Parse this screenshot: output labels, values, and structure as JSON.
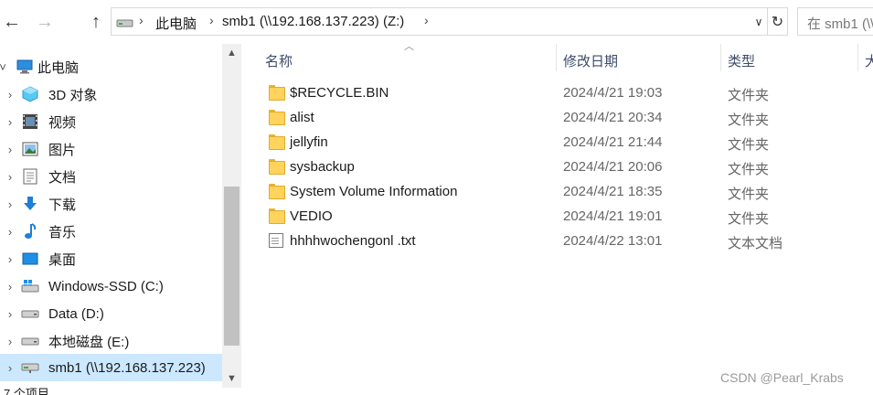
{
  "toolbar": {
    "back_icon": "←",
    "forward_icon": "→",
    "up_icon": "↑"
  },
  "address": {
    "crumbs": [
      "此电脑",
      "smb1 (\\\\192.168.137.223) (Z:)"
    ],
    "separator": "›",
    "dropdown_icon": "∨",
    "refresh_icon": "↻"
  },
  "search": {
    "placeholder": "在 smb1 (\\\\"
  },
  "nav": {
    "items": [
      {
        "label": "此电脑",
        "icon": "pc-icon",
        "expanded": true
      },
      {
        "label": "3D 对象",
        "icon": "3d-objects-icon"
      },
      {
        "label": "视频",
        "icon": "video-icon"
      },
      {
        "label": "图片",
        "icon": "pictures-icon"
      },
      {
        "label": "文档",
        "icon": "documents-icon"
      },
      {
        "label": "下载",
        "icon": "download-icon"
      },
      {
        "label": "音乐",
        "icon": "music-icon"
      },
      {
        "label": "桌面",
        "icon": "desktop-icon"
      },
      {
        "label": "Windows-SSD (C:)",
        "icon": "windows-drive-icon"
      },
      {
        "label": "Data (D:)",
        "icon": "drive-icon"
      },
      {
        "label": "本地磁盘 (E:)",
        "icon": "drive-icon"
      },
      {
        "label": "smb1 (\\\\192.168.137.223)",
        "icon": "network-drive-icon",
        "selected": true
      }
    ],
    "status_text": "7 个项目"
  },
  "list": {
    "columns": {
      "name": "名称",
      "date": "修改日期",
      "type": "类型",
      "size": "大"
    },
    "files": [
      {
        "name": "$RECYCLE.BIN",
        "date": "2024/4/21 19:03",
        "type": "文件夹",
        "icon": "folder-icon"
      },
      {
        "name": "alist",
        "date": "2024/4/21 20:34",
        "type": "文件夹",
        "icon": "folder-icon"
      },
      {
        "name": "jellyfin",
        "date": "2024/4/21 21:44",
        "type": "文件夹",
        "icon": "folder-icon"
      },
      {
        "name": "sysbackup",
        "date": "2024/4/21 20:06",
        "type": "文件夹",
        "icon": "folder-icon"
      },
      {
        "name": "System Volume Information",
        "date": "2024/4/21 18:35",
        "type": "文件夹",
        "icon": "folder-icon"
      },
      {
        "name": "VEDIO",
        "date": "2024/4/21 19:01",
        "type": "文件夹",
        "icon": "folder-icon"
      },
      {
        "name": "hhhhwochengonl .txt",
        "date": "2024/4/22 13:01",
        "type": "文本文档",
        "icon": "text-file-icon"
      }
    ]
  },
  "watermark": "CSDN @Pearl_Krabs"
}
